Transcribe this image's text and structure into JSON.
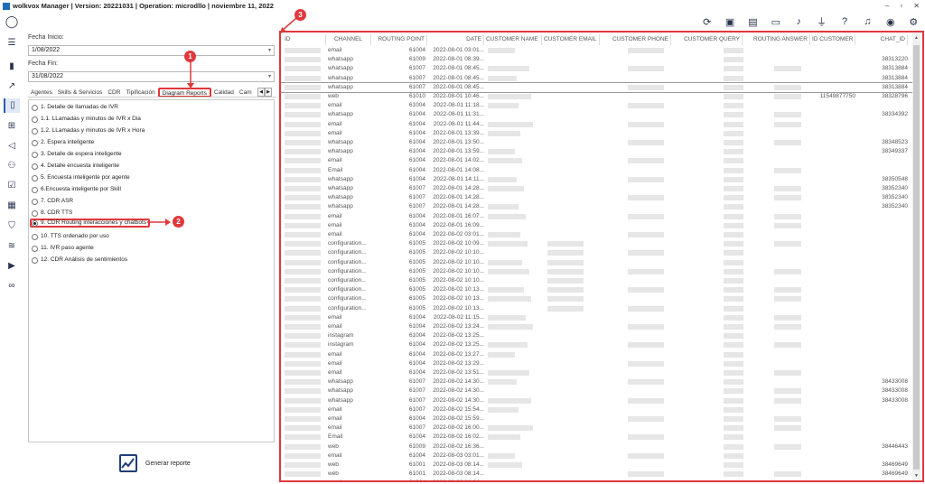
{
  "titlebar": {
    "text": "wolkvox Manager  |  Version: 20221031  |  Operation: microdllo  |  noviembre 11, 2022",
    "controls": [
      "–",
      "▫",
      "✕"
    ]
  },
  "topicons": [
    "refresh-icon",
    "briefcase-icon",
    "gallery-icon",
    "id-card-icon",
    "music-icon",
    "mic-icon",
    "help-icon",
    "bell-icon",
    "user-icon",
    "gear-icon"
  ],
  "sidebar": [
    "avatar-icon",
    "menu-icon",
    "bar-chart-icon",
    "line-chart-icon",
    "document-icon",
    "diagram-icon",
    "megaphone-icon",
    "group-icon",
    "checklist-icon",
    "calculator-icon",
    "shield-icon",
    "audio-icon",
    "video-icon",
    "voicemail-icon"
  ],
  "filters": {
    "start_label": "Fecha Inicio:",
    "start_value": "1/08/2022",
    "end_label": "Fecha Fin:",
    "end_value": "31/08/2022"
  },
  "tabs": [
    "Agentes",
    "Skills & Servicios",
    "CDR",
    "Tipificación",
    "Diagram Reports",
    "Calidad",
    "Cam"
  ],
  "reports": [
    "1. Detalle de llamadas de IVR",
    "1.1. LLamadas y minutos de IVR x Dia",
    "1.2. LLamadas y minutos de IVR x Hora",
    "2. Espera inteligente",
    "3. Detalle de espera inteligente",
    "4. Detalle encuesta inteligente",
    "5. Encuesta inteligente por agente",
    "6.Encuesta inteligente por Skill",
    "7. CDR ASR",
    "8. CDR TTS",
    "9. CDR Routing interacciones y chatbots",
    "10. TTS ordenado por uso",
    "11. IVR paso agente",
    "12. CDR Análisis de sentimientos"
  ],
  "generate_label": "Generar reporte",
  "callouts": [
    "1",
    "2",
    "3"
  ],
  "table": {
    "headers": [
      "ID",
      "CHANNEL",
      "ROUTING POINT",
      "DATE",
      "CUSTOMER NAME",
      "CUSTOMER EMAIL",
      "CUSTOMER PHONE",
      "CUSTOMER QUERY",
      "ROUTING ANSWER",
      "ID CUSTOMER",
      "CHAT_ID"
    ],
    "rows": [
      [
        "email",
        "61004",
        "2022-08-01 03:01...",
        "",
        ""
      ],
      [
        "whatsapp",
        "61009",
        "2022-08-01 08:39...",
        "",
        "38313220"
      ],
      [
        "whatsapp",
        "61007",
        "2022-08-01 08:45...",
        "",
        "38313884"
      ],
      [
        "whatsapp",
        "61007",
        "2022-08-01 08:45...",
        "",
        "38313884"
      ],
      [
        "whatsapp",
        "61007",
        "2022-08-01 08:45...",
        "",
        "38313884"
      ],
      [
        "web",
        "61010",
        "2022-08-01 10:46...",
        "11549877750",
        "38328796"
      ],
      [
        "email",
        "61004",
        "2022-08-01 11:18...",
        "",
        ""
      ],
      [
        "whatsapp",
        "61004",
        "2022-08-01 11:31...",
        "",
        "38334392"
      ],
      [
        "email",
        "61004",
        "2022-08-01 11:44...",
        "",
        ""
      ],
      [
        "email",
        "61004",
        "2022-08-01 13:39...",
        "",
        ""
      ],
      [
        "whatsapp",
        "61004",
        "2022-08-01 13:50...",
        "",
        "38348523"
      ],
      [
        "whatsapp",
        "61004",
        "2022-08-01 13:59...",
        "",
        "38349337"
      ],
      [
        "email",
        "61004",
        "2022-08-01 14:02...",
        "",
        ""
      ],
      [
        "Email",
        "61004",
        "2022-08-01 14:08...",
        "",
        ""
      ],
      [
        "whatsapp",
        "61004",
        "2022-08-01 14:11...",
        "",
        "38350548"
      ],
      [
        "whatsapp",
        "61007",
        "2022-08-01 14:28...",
        "",
        "38352340"
      ],
      [
        "whatsapp",
        "61007",
        "2022-08-01 14:28...",
        "",
        "38352340"
      ],
      [
        "whatsapp",
        "61007",
        "2022-08-01 14:28...",
        "",
        "38352340"
      ],
      [
        "email",
        "61004",
        "2022-08-01 16:07...",
        "",
        ""
      ],
      [
        "email",
        "61004",
        "2022-08-01 16:09...",
        "",
        ""
      ],
      [
        "email",
        "61004",
        "2022-08-02 03:01...",
        "",
        ""
      ],
      [
        "configuration...",
        "61005",
        "2022-08-02 10:09...",
        "",
        ""
      ],
      [
        "configuration...",
        "61005",
        "2022-08-02 10:10...",
        "",
        ""
      ],
      [
        "configuration...",
        "61005",
        "2022-08-02 10:10...",
        "",
        ""
      ],
      [
        "configuration...",
        "61005",
        "2022-08-02 10:10...",
        "",
        ""
      ],
      [
        "configuration...",
        "61005",
        "2022-08-02 10:10...",
        "",
        ""
      ],
      [
        "configuration...",
        "61005",
        "2022-08-02 10:13...",
        "",
        ""
      ],
      [
        "configuration...",
        "61005",
        "2022-08-02 10:13...",
        "",
        ""
      ],
      [
        "configuration...",
        "61005",
        "2022-08-02 10:13...",
        "",
        ""
      ],
      [
        "email",
        "61004",
        "2022-08-02 11:15...",
        "",
        ""
      ],
      [
        "email",
        "61004",
        "2022-08-02 13:24...",
        "",
        ""
      ],
      [
        "instagram",
        "61004",
        "2022-08-02 13:25...",
        "",
        ""
      ],
      [
        "instagram",
        "61004",
        "2022-08-02 13:25...",
        "",
        ""
      ],
      [
        "email",
        "61004",
        "2022-08-02 13:27...",
        "",
        ""
      ],
      [
        "email",
        "61004",
        "2022-08-02 13:29...",
        "",
        ""
      ],
      [
        "email",
        "61004",
        "2022-08-02 13:51...",
        "",
        ""
      ],
      [
        "whatsapp",
        "61007",
        "2022-08-02 14:30...",
        "",
        "38433008"
      ],
      [
        "whatsapp",
        "61007",
        "2022-08-02 14:30...",
        "",
        "38433008"
      ],
      [
        "whatsapp",
        "61007",
        "2022-08-02 14:30...",
        "",
        "38433008"
      ],
      [
        "email",
        "61007",
        "2022-08-02 15:54...",
        "",
        ""
      ],
      [
        "email",
        "61004",
        "2022-08-02 15:59...",
        "",
        ""
      ],
      [
        "email",
        "61007",
        "2022-08-02 16:00...",
        "",
        ""
      ],
      [
        "Email",
        "61004",
        "2022-08-02 16:02...",
        "",
        ""
      ],
      [
        "web",
        "61009",
        "2022-08-02 16:36...",
        "",
        "38446443"
      ],
      [
        "email",
        "61004",
        "2022-08-03 03:01...",
        "",
        ""
      ],
      [
        "web",
        "61001",
        "2022-08-03 08:14...",
        "",
        "38469649"
      ],
      [
        "web",
        "61001",
        "2022-08-03 08:14...",
        "",
        "38469649"
      ],
      [
        "email",
        "61004",
        "2022-08-03 08:24...",
        "",
        ""
      ]
    ]
  }
}
